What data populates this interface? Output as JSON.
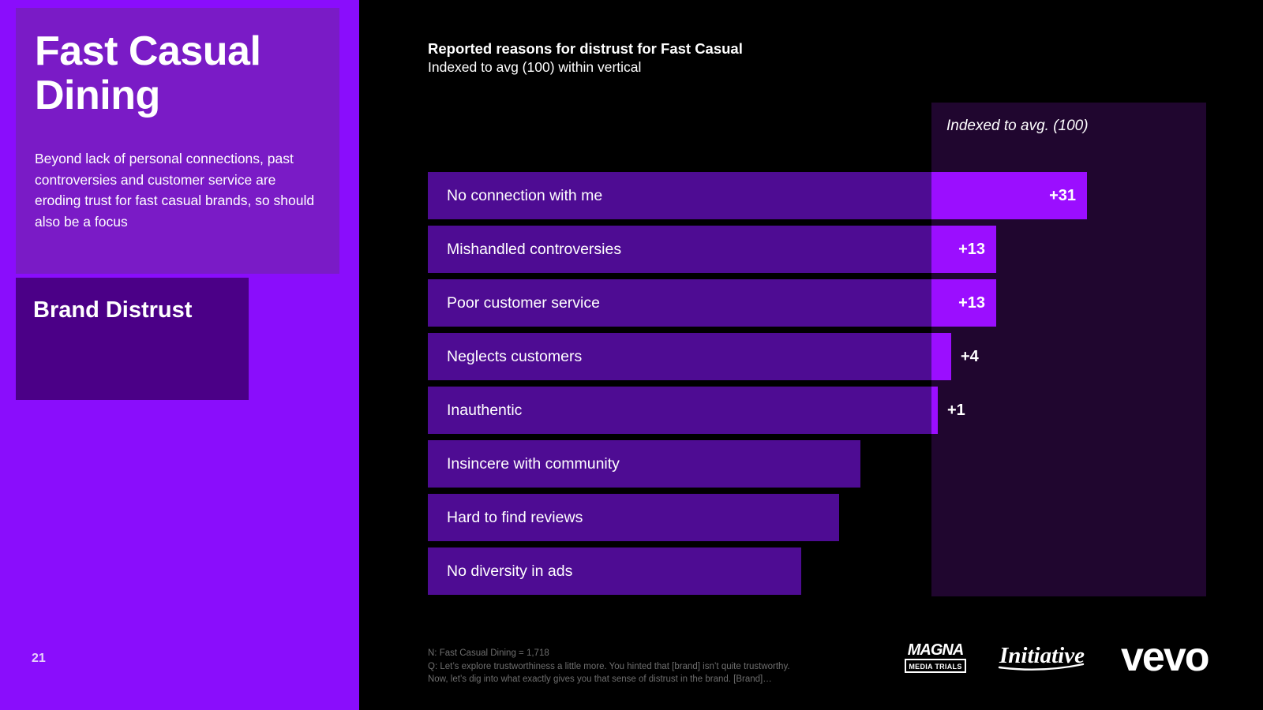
{
  "slide": {
    "page_number": "21",
    "deck_title": "Fast Casual Dining",
    "deck_subtitle": "Beyond lack of personal connections, past controversies and customer service are eroding trust for fast casual brands, so should also be a focus",
    "section_title": "Brand Distrust",
    "accent_color": "#8A0DFC",
    "title_card_color": "#7A1BC6",
    "section_card_color": "#4B0087",
    "panel_color": "#20062F",
    "bar_base_color": "#4E0C93",
    "bar_ext_color": "#9B0EFF"
  },
  "chart_data": {
    "type": "bar",
    "title": "Reported reasons for distrust for Fast Casual",
    "subtitle": "Indexed to avg (100) within vertical",
    "panel_label": "Indexed to avg. (100)",
    "xlabel": "",
    "ylabel": "",
    "orientation": "horizontal",
    "baseline": 100,
    "grid": false,
    "legend": "none",
    "categories": [
      "No connection with me",
      "Mishandled controversies",
      "Poor customer service",
      "Neglects customers",
      "Inauthentic",
      "Insincere with community",
      "Hard to find reviews",
      "No diversity in ads"
    ],
    "values": [
      31,
      13,
      13,
      4,
      1,
      -8,
      -11,
      -14
    ],
    "value_labels": [
      "+31",
      "+13",
      "+13",
      "+4",
      "+1",
      "",
      "",
      ""
    ],
    "bars": [
      {
        "label": "No connection with me",
        "value": 31,
        "value_label": "+31",
        "base_w": 638,
        "ext_w": 197,
        "label_inside": true
      },
      {
        "label": "Mishandled controversies",
        "value": 13,
        "value_label": "+13",
        "base_w": 638,
        "ext_w": 82,
        "label_inside": true
      },
      {
        "label": "Poor customer service",
        "value": 13,
        "value_label": "+13",
        "base_w": 638,
        "ext_w": 82,
        "label_inside": true
      },
      {
        "label": "Neglects customers",
        "value": 4,
        "value_label": "+4",
        "base_w": 638,
        "ext_w": 25,
        "label_inside": false
      },
      {
        "label": "Inauthentic",
        "value": 1,
        "value_label": "+1",
        "base_w": 638,
        "ext_w": 8,
        "label_inside": false
      },
      {
        "label": "Insincere with community",
        "value": null,
        "value_label": "",
        "base_w": 548,
        "ext_w": 0,
        "label_inside": false
      },
      {
        "label": "Hard to find reviews",
        "value": null,
        "value_label": "",
        "base_w": 521,
        "ext_w": 0,
        "label_inside": false
      },
      {
        "label": "No diversity in ads",
        "value": null,
        "value_label": "",
        "base_w": 473,
        "ext_w": 0,
        "label_inside": false
      }
    ]
  },
  "footnote": {
    "line1": "N: Fast Casual Dining = 1,718",
    "line2": "Q: Let’s explore trustworthiness a little more. You hinted that [brand] isn’t quite trustworthy.",
    "line3": "Now, let’s dig into what exactly gives you that sense of distrust in the brand. [Brand]…"
  },
  "logos": {
    "magna": "MAGNA",
    "magna_sub": "MEDIA TRIALS",
    "initiative": "Initiative",
    "vevo": "vevo"
  }
}
